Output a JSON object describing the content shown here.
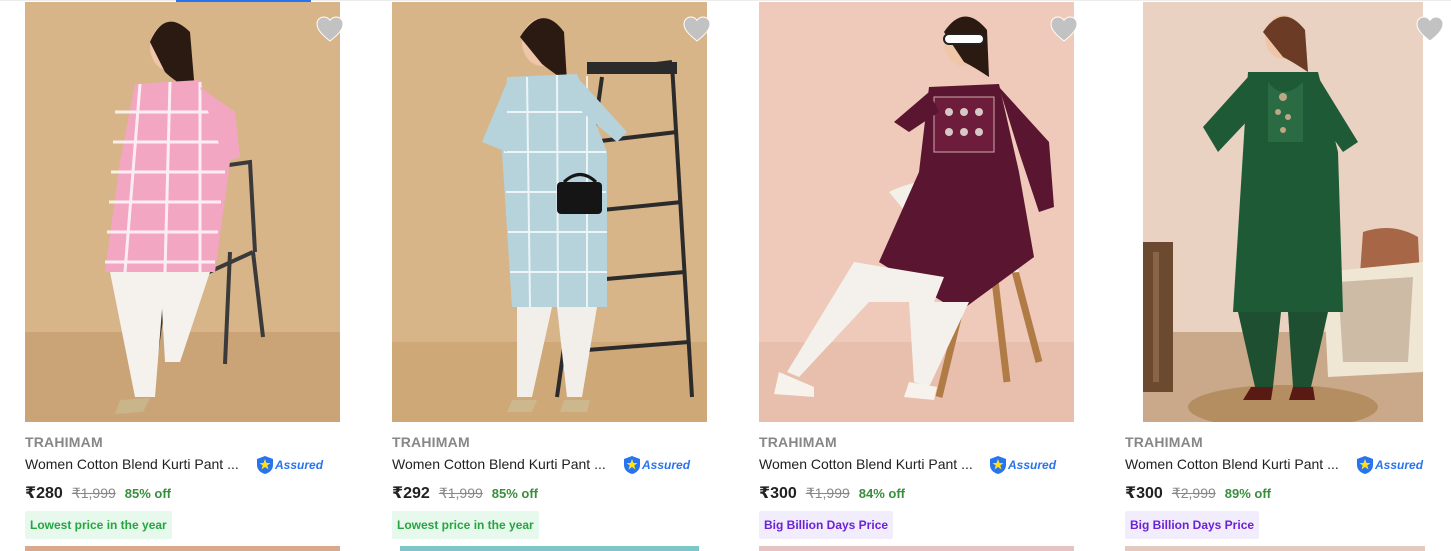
{
  "colors": {
    "accent": "#2874f0",
    "discount_green": "#388e3c",
    "tag_green_text": "#26a541",
    "tag_green_bg": "#e7f8ec",
    "tag_purple_text": "#6b21d7",
    "tag_purple_bg": "#f2edfd"
  },
  "products": [
    {
      "brand": "TRAHIMAM",
      "title": "Women Cotton Blend Kurti Pant ...",
      "assured_label": "Assured",
      "price": "₹280",
      "mrp": "₹1,999",
      "discount": "85% off",
      "tag": "Lowest price in the year",
      "tag_style": "green",
      "image_icon": "product-photo-pink-kurti"
    },
    {
      "brand": "TRAHIMAM",
      "title": "Women Cotton Blend Kurti Pant ...",
      "assured_label": "Assured",
      "price": "₹292",
      "mrp": "₹1,999",
      "discount": "85% off",
      "tag": "Lowest price in the year",
      "tag_style": "green",
      "image_icon": "product-photo-blue-kurti"
    },
    {
      "brand": "TRAHIMAM",
      "title": "Women Cotton Blend Kurti Pant ...",
      "assured_label": "Assured",
      "price": "₹300",
      "mrp": "₹1,999",
      "discount": "84% off",
      "tag": "Big Billion Days Price",
      "tag_style": "purple",
      "image_icon": "product-photo-maroon-kurti"
    },
    {
      "brand": "TRAHIMAM",
      "title": "Women Cotton Blend Kurti Pant ...",
      "assured_label": "Assured",
      "price": "₹300",
      "mrp": "₹2,999",
      "discount": "89% off",
      "tag": "Big Billion Days Price",
      "tag_style": "purple",
      "image_icon": "product-photo-green-kurti"
    }
  ],
  "icons": {
    "wishlist": "heart-icon",
    "assured": "assured-badge-icon"
  }
}
